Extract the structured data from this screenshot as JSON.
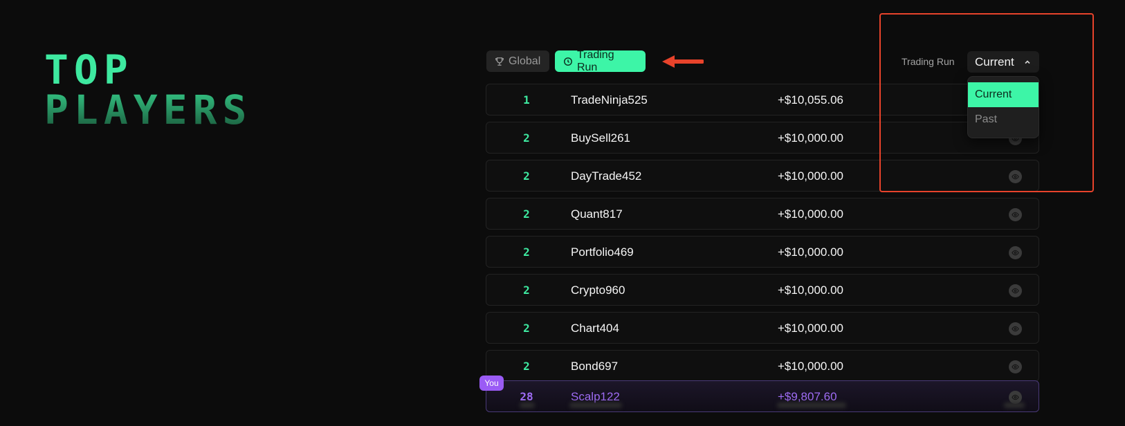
{
  "title": {
    "line1": "TOP",
    "line2": "PLAYERS"
  },
  "tabs": [
    {
      "label": "Global",
      "icon": "trophy-icon",
      "active": false
    },
    {
      "label": "Trading Run",
      "icon": "clock-icon",
      "active": true
    }
  ],
  "filter": {
    "label": "Trading Run",
    "selected": "Current",
    "options": [
      "Current",
      "Past"
    ]
  },
  "leaderboard": {
    "rows": [
      {
        "rank": "1",
        "name": "TradeNinja525",
        "gain": "+$10,055.06"
      },
      {
        "rank": "2",
        "name": "BuySell261",
        "gain": "+$10,000.00"
      },
      {
        "rank": "2",
        "name": "DayTrade452",
        "gain": "+$10,000.00"
      },
      {
        "rank": "2",
        "name": "Quant817",
        "gain": "+$10,000.00"
      },
      {
        "rank": "2",
        "name": "Portfolio469",
        "gain": "+$10,000.00"
      },
      {
        "rank": "2",
        "name": "Crypto960",
        "gain": "+$10,000.00"
      },
      {
        "rank": "2",
        "name": "Chart404",
        "gain": "+$10,000.00"
      },
      {
        "rank": "2",
        "name": "Bond697",
        "gain": "+$10,000.00"
      }
    ],
    "you": {
      "badge": "You",
      "rank": "28",
      "name": "Scalp122",
      "gain": "+$9,807.60"
    }
  },
  "colors": {
    "accent": "#3df5a7",
    "you": "#9a5bf5",
    "annotation": "#e8432b"
  }
}
